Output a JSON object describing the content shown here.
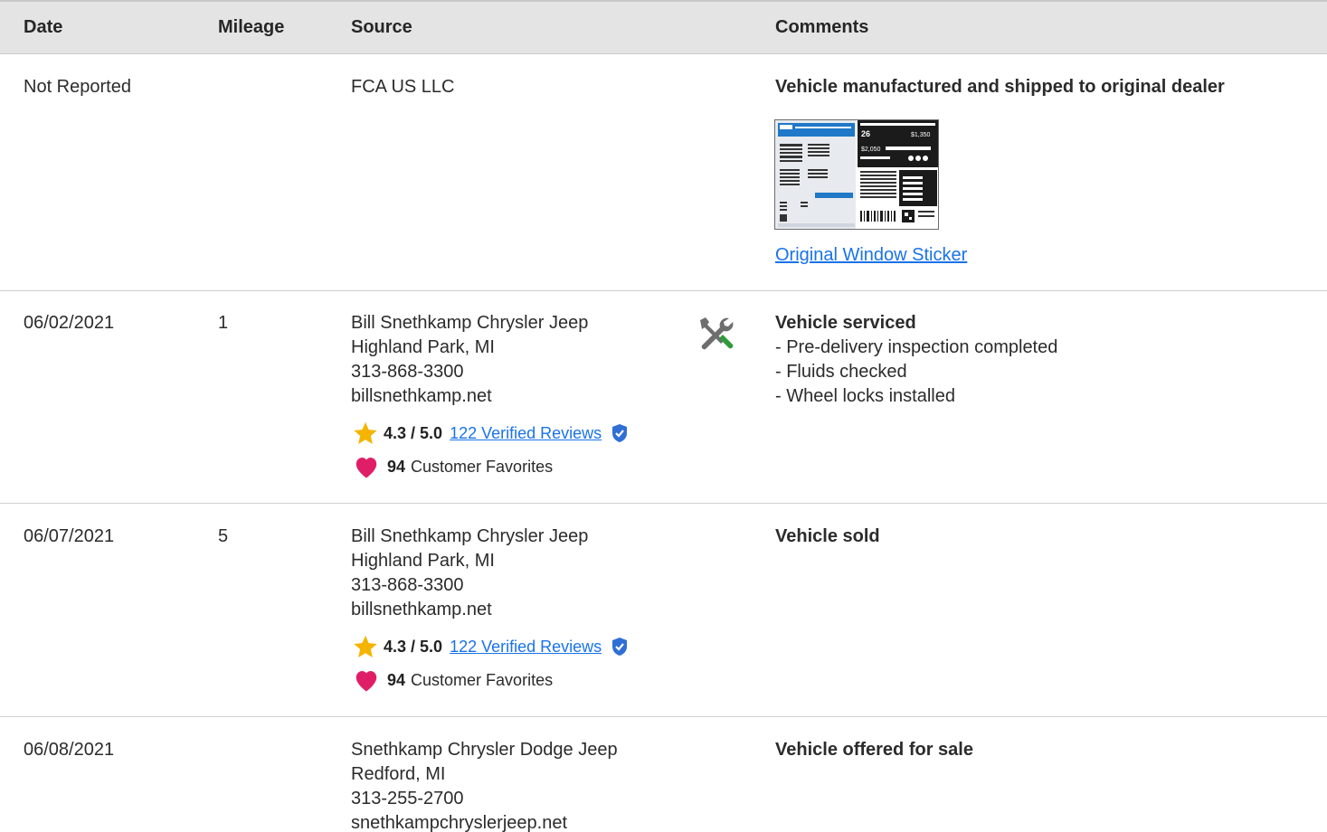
{
  "header": {
    "date": "Date",
    "mileage": "Mileage",
    "source": "Source",
    "comments": "Comments"
  },
  "rows": [
    {
      "date": "Not Reported",
      "mileage": "",
      "source": [
        "FCA US LLC"
      ],
      "comment_title": "Vehicle manufactured and shipped to original dealer",
      "comment_items": [],
      "sticker_link": "Original Window Sticker"
    },
    {
      "date": "06/02/2021",
      "mileage": "1",
      "source": [
        "Bill Snethkamp Chrysler Jeep",
        "Highland Park, MI",
        "313-868-3300",
        "billsnethkamp.net"
      ],
      "rating": "4.3 / 5.0",
      "reviews_link": "122 Verified Reviews",
      "favorites_count": "94",
      "favorites_label": "Customer Favorites",
      "comment_title": "Vehicle serviced",
      "comment_items": [
        "- Pre-delivery inspection completed",
        "- Fluids checked",
        "- Wheel locks installed"
      ]
    },
    {
      "date": "06/07/2021",
      "mileage": "5",
      "source": [
        "Bill Snethkamp Chrysler Jeep",
        "Highland Park, MI",
        "313-868-3300",
        "billsnethkamp.net"
      ],
      "rating": "4.3 / 5.0",
      "reviews_link": "122 Verified Reviews",
      "favorites_count": "94",
      "favorites_label": "Customer Favorites",
      "comment_title": "Vehicle sold",
      "comment_items": []
    },
    {
      "date": "06/08/2021",
      "mileage": "",
      "source": [
        "Snethkamp Chrysler Dodge Jeep",
        "Redford, MI",
        "313-255-2700",
        "snethkampchryslerjeep.net"
      ],
      "comment_title": "Vehicle offered for sale",
      "comment_items": []
    }
  ],
  "sticker": {
    "mpg": "26",
    "price_a": "$1,350",
    "price_b": "$2,050"
  },
  "icons": {
    "star": "star-icon",
    "verified": "verified-shield-icon",
    "heart": "heart-icon",
    "service": "wrench-screwdriver-icon"
  },
  "colors": {
    "link": "#1a73e8",
    "star": "#f5b400",
    "heart": "#e01e68",
    "verified": "#2f6fd6",
    "header_bg": "#e4e4e4"
  }
}
